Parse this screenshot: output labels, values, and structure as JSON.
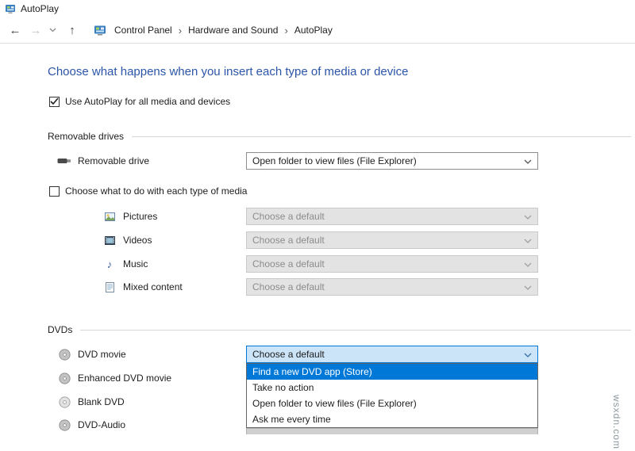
{
  "window": {
    "title": "AutoPlay"
  },
  "toolbar": {
    "breadcrumb": {
      "separator": "›",
      "items": [
        "Control Panel",
        "Hardware and Sound",
        "AutoPlay"
      ]
    }
  },
  "page": {
    "heading": "Choose what happens when you insert each type of media or device",
    "use_autoplay_label": "Use AutoPlay for all media and devices",
    "use_autoplay_checked": true
  },
  "removable_section": {
    "title": "Removable drives",
    "drive_row": {
      "label": "Removable drive",
      "value": "Open folder to view files (File Explorer)"
    },
    "choose_media_label": "Choose what to do with each type of media",
    "choose_media_checked": false,
    "media_rows": [
      {
        "label": "Pictures",
        "value": "Choose a default"
      },
      {
        "label": "Videos",
        "value": "Choose a default"
      },
      {
        "label": "Music",
        "value": "Choose a default"
      },
      {
        "label": "Mixed content",
        "value": "Choose a default"
      }
    ]
  },
  "dvd_section": {
    "title": "DVDs",
    "rows": [
      {
        "label": "DVD movie",
        "value": "Choose a default"
      },
      {
        "label": "Enhanced DVD movie"
      },
      {
        "label": "Blank DVD"
      },
      {
        "label": "DVD-Audio"
      }
    ],
    "open_dropdown": {
      "owner": "DVD movie",
      "options": [
        "Find a new DVD app (Store)",
        "Take no action",
        "Open folder to view files (File Explorer)",
        "Ask me every time"
      ],
      "highlighted": "Find a new DVD app (Store)"
    }
  },
  "watermark": "wsxdn.com",
  "colors": {
    "heading": "#2b55a8",
    "highlight": "#0078d7",
    "focused_combo_bg": "#cce4f7"
  }
}
